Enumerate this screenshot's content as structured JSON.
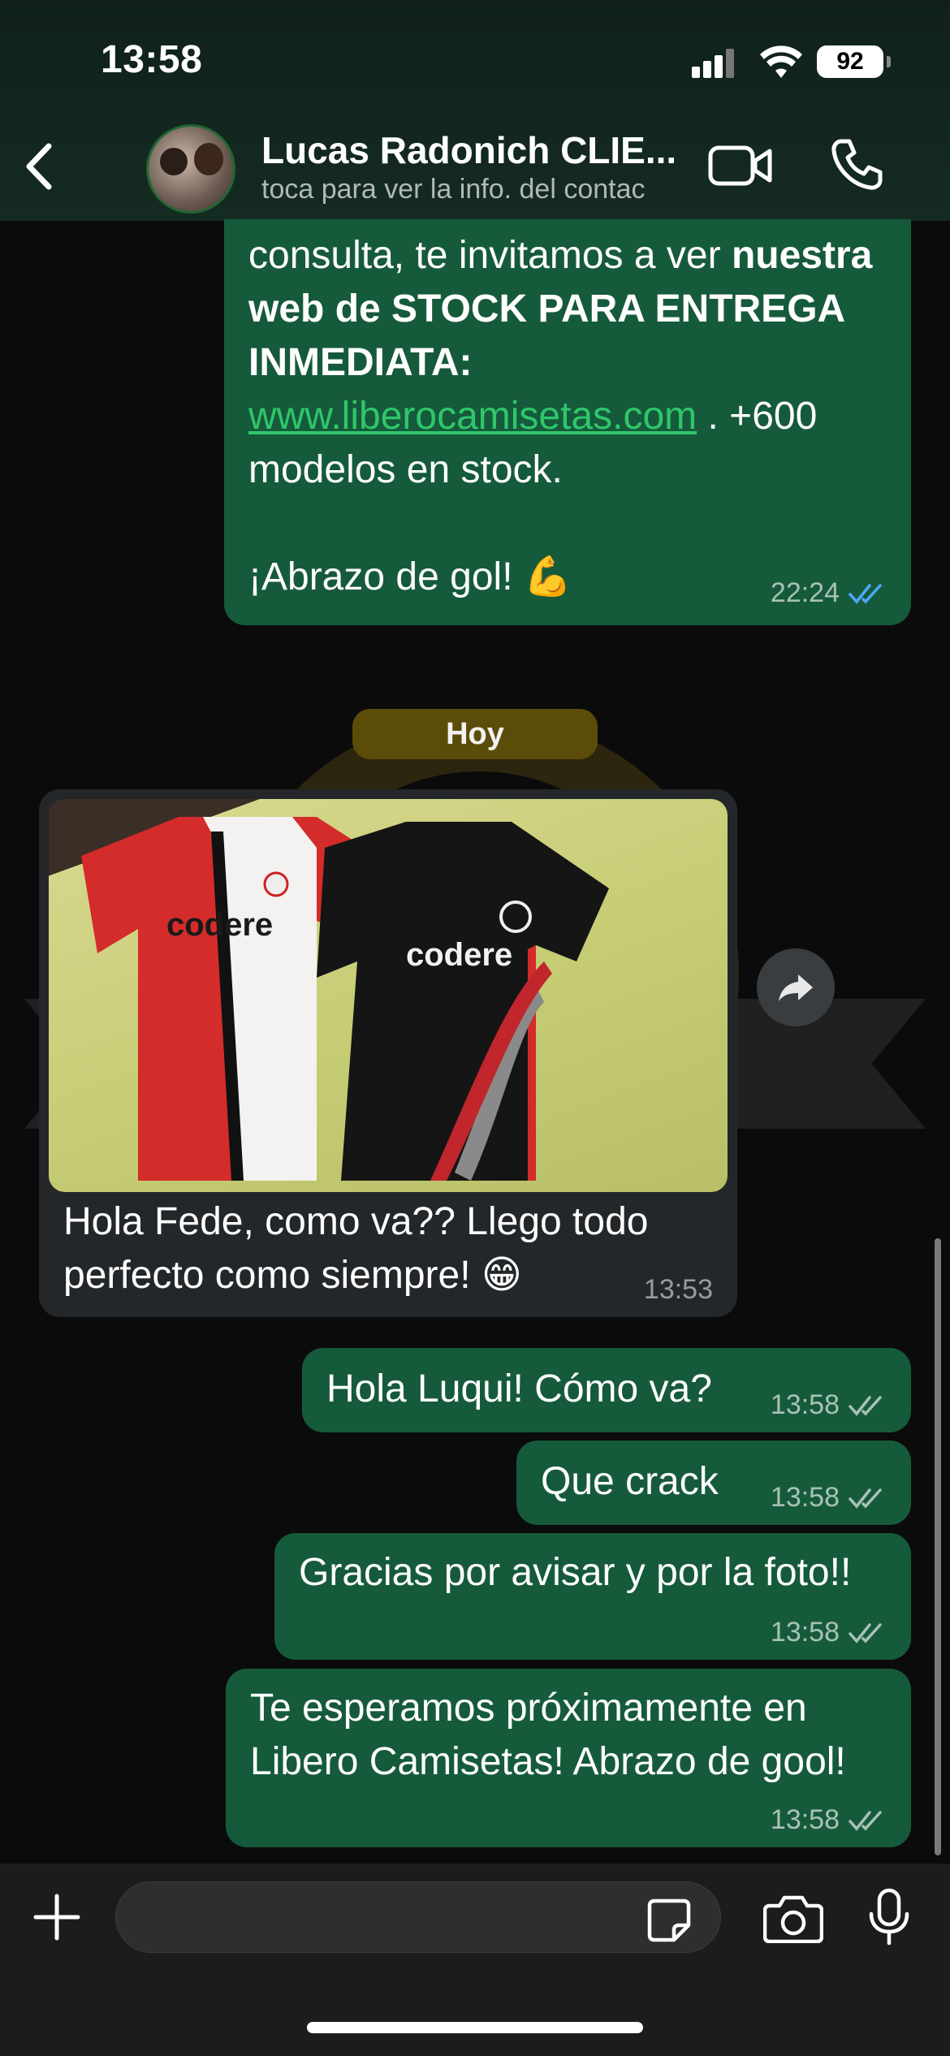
{
  "status_bar": {
    "time": "13:58",
    "battery": "92",
    "icons": [
      "signal-icon",
      "wifi-icon",
      "battery-icon"
    ]
  },
  "header": {
    "contact_name": "Lucas Radonich CLIE...",
    "subtitle": "toca para ver la info. del contac",
    "icons": [
      "back-chevron-icon",
      "contact-avatar",
      "video-call-icon",
      "phone-call-icon"
    ]
  },
  "messages": {
    "m1": {
      "direction": "outgoing",
      "part1": "consulta, te invitamos a ver ",
      "bold": "nuestra web de STOCK PARA ENTREGA INMEDIATA:",
      "link": "www.liberocamisetas.com",
      "part2": " . +600 modelos en stock.",
      "part3": "¡Abrazo de gol! 💪",
      "time": "22:24",
      "status": "read"
    },
    "day_separator": "Hoy",
    "m2": {
      "direction": "incoming",
      "has_photo": true,
      "photo_text_left": "codere",
      "photo_text_right": "codere",
      "text": "Hola Fede, como va?? Llego todo perfecto como siempre! 😁",
      "time": "13:53"
    },
    "m3": {
      "direction": "outgoing",
      "text": "Hola Luqui! Cómo va?",
      "time": "13:58",
      "status": "delivered"
    },
    "m4": {
      "direction": "outgoing",
      "text": "Que crack",
      "time": "13:58",
      "status": "delivered"
    },
    "m5": {
      "direction": "outgoing",
      "text": "Gracias por avisar y por la foto!!",
      "time": "13:58",
      "status": "delivered"
    },
    "m6": {
      "direction": "outgoing",
      "text": "Te esperamos próximamente en Libero Camisetas! Abrazo de gool!",
      "time": "13:58",
      "status": "delivered"
    }
  },
  "input_bar": {
    "placeholder": "",
    "icons": [
      "plus-icon",
      "sticker-icon",
      "camera-icon",
      "microphone-icon"
    ]
  },
  "colors": {
    "outgoing_bubble": "#165a3c",
    "incoming_bubble": "#24272a",
    "link": "#2ec76a",
    "read_ticks": "#4fa8ff",
    "day_pill": "#5b4d09"
  }
}
